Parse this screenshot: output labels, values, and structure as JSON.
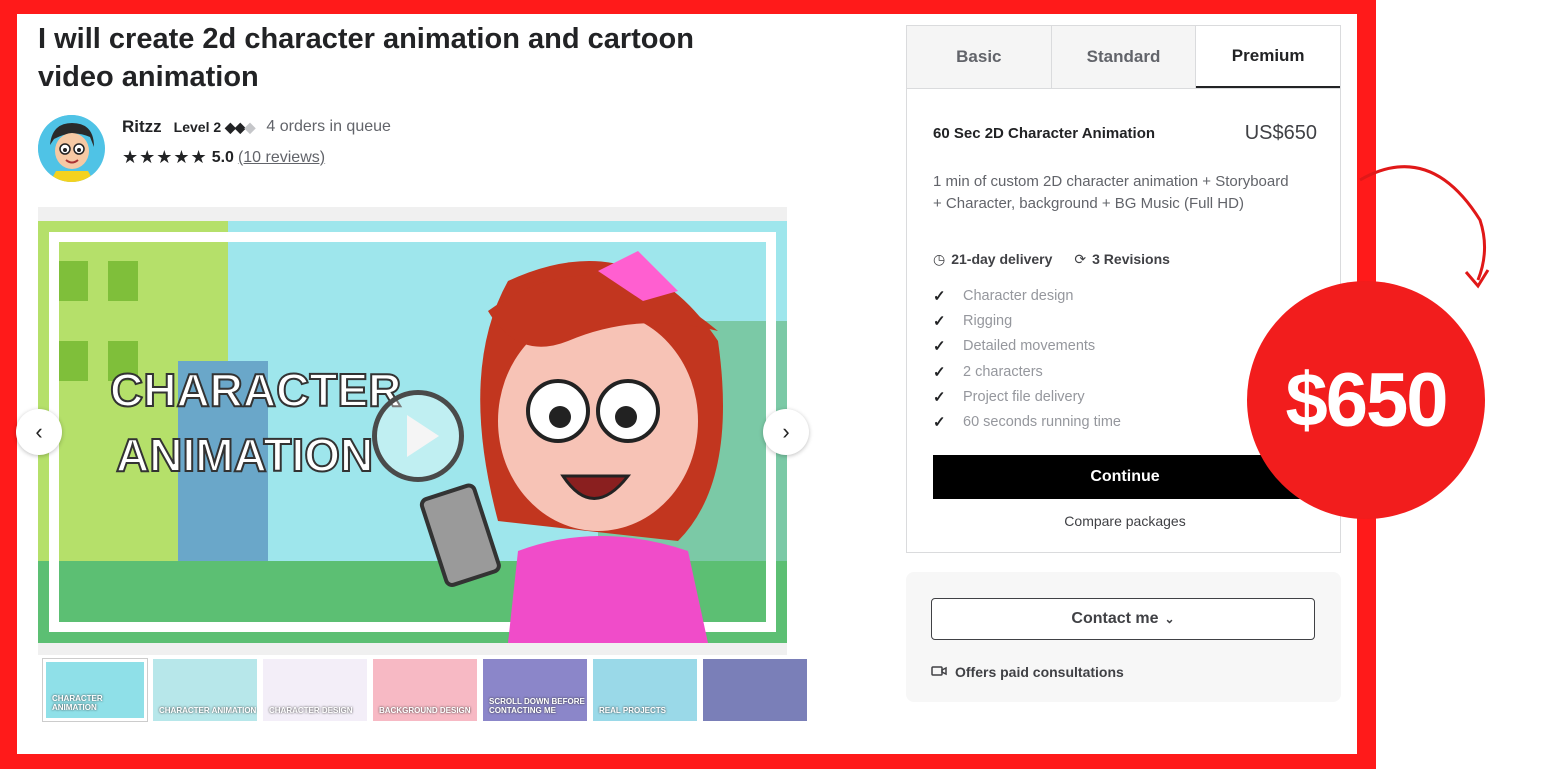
{
  "gig": {
    "title": "I will create 2d character animation and cartoon video animation"
  },
  "seller": {
    "name": "Ritzz",
    "level_label": "Level 2",
    "queue": "4 orders in queue",
    "stars": "★★★★★",
    "rating": "5.0",
    "reviews": "(10 reviews)"
  },
  "gallery": {
    "overlay_line1": "CHARACTER",
    "overlay_line2": "ANIMATION",
    "thumbnails": [
      {
        "label": "CHARACTER ANIMATION",
        "color": "#8fe0e8"
      },
      {
        "label": "CHARACTER ANIMATION",
        "color": "#b7e7ea"
      },
      {
        "label": "CHARACTER DESIGN",
        "color": "#f3eef8"
      },
      {
        "label": "BACKGROUND DESIGN",
        "color": "#f7b9c4"
      },
      {
        "label": "SCROLL DOWN BEFORE CONTACTING ME",
        "color": "#8b86c9"
      },
      {
        "label": "REAL PROJECTS",
        "color": "#9ad9e8"
      },
      {
        "label": "",
        "color": "#7a7fb8"
      }
    ]
  },
  "package": {
    "tabs": [
      "Basic",
      "Standard",
      "Premium"
    ],
    "active_tab": "Premium",
    "name": "60 Sec 2D Character Animation",
    "price": "US$650",
    "description": "1 min of custom 2D character animation + Storyboard + Character, background + BG Music (Full HD)",
    "delivery": "21-day delivery",
    "revisions": "3 Revisions",
    "features": [
      "Character design",
      "Rigging",
      "Detailed movements",
      "2 characters",
      "Project file delivery",
      "60 seconds running time"
    ],
    "continue_label": "Continue",
    "compare_label": "Compare packages"
  },
  "contact": {
    "button_label": "Contact me",
    "consultation_label": "Offers paid consultations"
  },
  "badge": {
    "price": "$650"
  },
  "colors": {
    "frame": "#ff1a1a",
    "badge": "#f21d1d",
    "cta": "#000000"
  }
}
